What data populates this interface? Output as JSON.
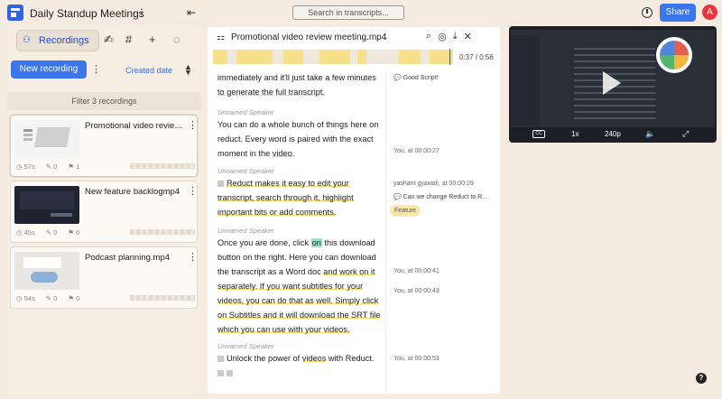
{
  "header": {
    "title": "Daily Standup Meetings",
    "search_placeholder": "Search in transcripts...",
    "share_label": "Share",
    "avatar_initial": "A"
  },
  "sidebar": {
    "tab_recordings": "Recordings",
    "new_recording": "New recording",
    "sort_label": "Created date",
    "filter_label": "Filter 3 recordings",
    "recordings": [
      {
        "title": "Promotional video review...",
        "duration": "57s",
        "highlights": "0",
        "tags": "1"
      },
      {
        "title": "New feature backlogmp4",
        "duration": "45s",
        "highlights": "0",
        "tags": "0"
      },
      {
        "title": "Podcast planning.mp4",
        "duration": "54s",
        "highlights": "0",
        "tags": "0"
      }
    ]
  },
  "transcript": {
    "file_name": "Promotional video review meeting.mp4",
    "time": "0:37 / 0:56",
    "paragraphs": [
      {
        "line1": "immediately and it'll just take a few minutes",
        "line2": "to generate the full transcript."
      },
      {
        "speaker": "Unnamed Speaker",
        "l1": "You can do a whole bunch of things here on",
        "l2": "reduct. Every word is paired with the exact",
        "l3a": "moment in the ",
        "l3b": "video",
        "l3c": "."
      },
      {
        "speaker": "Unnamed Speaker",
        "l1": "Reduct makes it easy to edit your",
        "l2": "transcript, search through it, highlight",
        "l3": "important bits or add comments."
      },
      {
        "speaker": "Unnamed Speaker",
        "l1a": "Once you are done, click ",
        "l1b": "on",
        "l1c": " this download",
        "l2": "button on the right. Here you can download",
        "l3a": "the transcript as a Word doc ",
        "l3b": "and work on it",
        "l4": "separately. If you want subtitles for your",
        "l5": "videos, you can do that as well. Simply click",
        "l6": "on Subtitles and it will download the SRT file",
        "l7": "which you can use with your videos."
      },
      {
        "speaker": "Unnamed Speaker",
        "l1a": "Unlock the power of ",
        "l1b": "videos",
        "l1c": " with Reduct."
      }
    ],
    "notes": {
      "comment1": "Good Script!",
      "time1": "You, at 00:00:27",
      "author2": "yashant gyawali, at 00:00:29",
      "comment2": "Can we change Reduct to R...",
      "tag2": "Feature",
      "time3": "You, at 00:00:41",
      "time4": "You, at 00:00:43",
      "time5": "You, at 00:00:53"
    }
  },
  "video": {
    "cc": "CC",
    "speed": "1x",
    "quality": "240p"
  },
  "help": "?"
}
